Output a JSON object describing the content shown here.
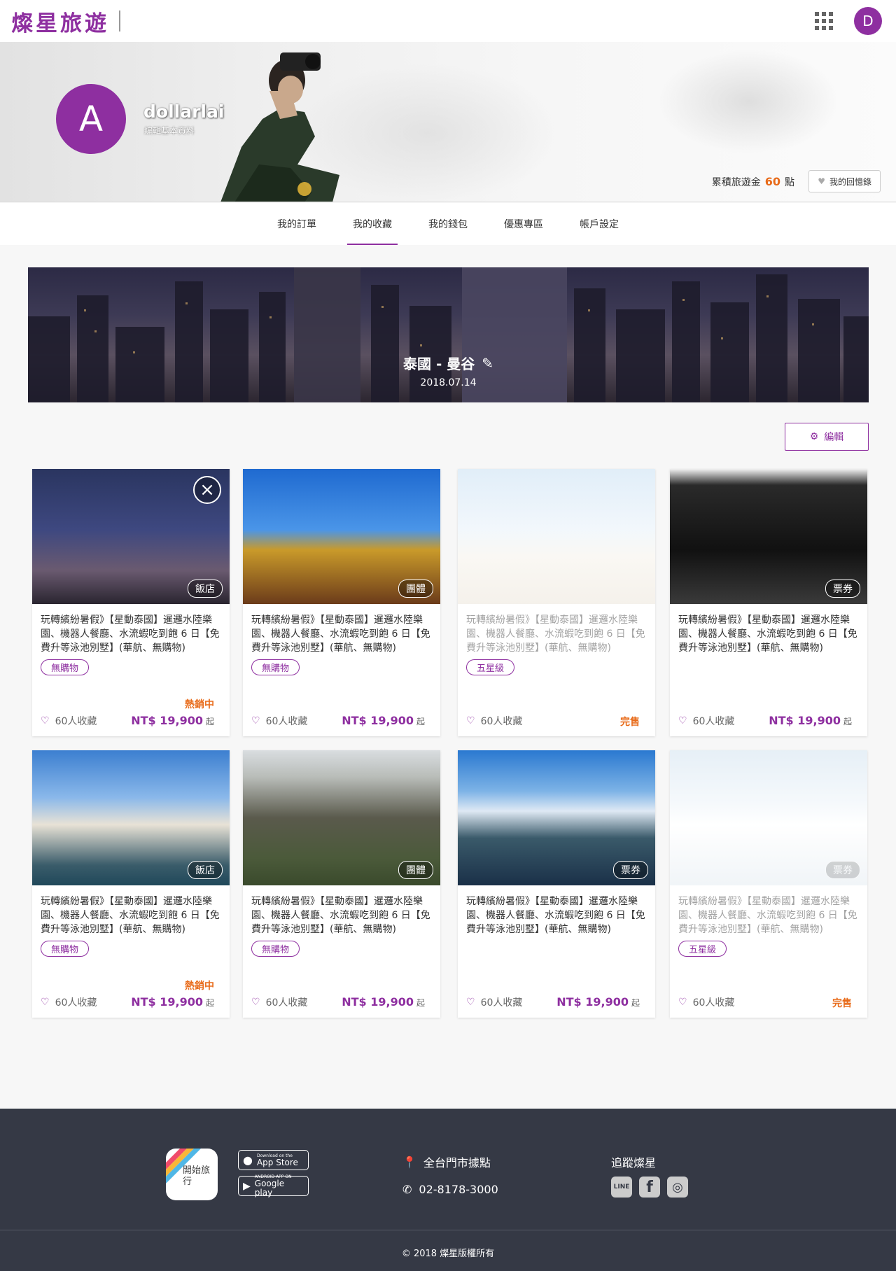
{
  "header": {
    "logo": "燦星旅遊",
    "user_initial": "D"
  },
  "profile": {
    "avatar_initial": "A",
    "name": "dollarlai",
    "edit_link": "編輯基本資料",
    "points_label": "累積旅遊金",
    "points_value": "60",
    "points_unit": "點",
    "memory_button": "我的回憶錄"
  },
  "tabs": [
    {
      "label": "我的訂單",
      "active": false
    },
    {
      "label": "我的收藏",
      "active": true
    },
    {
      "label": "我的錢包",
      "active": false
    },
    {
      "label": "優惠專區",
      "active": false
    },
    {
      "label": "帳戶設定",
      "active": false
    }
  ],
  "collection": {
    "title": "泰國 - 曼谷",
    "date": "2018.07.14",
    "edit_button": "編輯"
  },
  "cards": [
    {
      "badge": "飯店",
      "title": "玩轉繽紛暑假》【星動泰國】暹邏水陸樂園、機器人餐廳、水流蝦吃到飽 6 日【免費升等泳池別墅】(華航、無購物)",
      "tag": "無購物",
      "status": "熱銷中",
      "likes": "60人收藏",
      "price": "NT$ 19,900",
      "price_suffix": "起",
      "removable": true,
      "faded": false
    },
    {
      "badge": "團體",
      "title": "玩轉繽紛暑假》【星動泰國】暹邏水陸樂園、機器人餐廳、水流蝦吃到飽 6 日【免費升等泳池別墅】(華航、無購物)",
      "tag": "無購物",
      "status": "",
      "likes": "60人收藏",
      "price": "NT$ 19,900",
      "price_suffix": "起",
      "removable": false,
      "faded": false
    },
    {
      "badge": "",
      "title": "玩轉繽紛暑假》【星動泰國】暹邏水陸樂園、機器人餐廳、水流蝦吃到飽 6 日【免費升等泳池別墅】(華航、無購物)",
      "tag": "五星級",
      "status": "",
      "likes": "60人收藏",
      "price": "",
      "price_suffix": "",
      "soldout": "完售",
      "removable": false,
      "faded": true
    },
    {
      "badge": "票券",
      "title": "玩轉繽紛暑假》【星動泰國】暹邏水陸樂園、機器人餐廳、水流蝦吃到飽 6 日【免費升等泳池別墅】(華航、無購物)",
      "tag": "",
      "status": "",
      "likes": "60人收藏",
      "price": "NT$ 19,900",
      "price_suffix": "起",
      "removable": false,
      "faded": false
    },
    {
      "badge": "飯店",
      "title": "玩轉繽紛暑假》【星動泰國】暹邏水陸樂園、機器人餐廳、水流蝦吃到飽 6 日【免費升等泳池別墅】(華航、無購物)",
      "tag": "無購物",
      "status": "熱銷中",
      "likes": "60人收藏",
      "price": "NT$ 19,900",
      "price_suffix": "起",
      "removable": false,
      "faded": false
    },
    {
      "badge": "團體",
      "title": "玩轉繽紛暑假》【星動泰國】暹邏水陸樂園、機器人餐廳、水流蝦吃到飽 6 日【免費升等泳池別墅】(華航、無購物)",
      "tag": "無購物",
      "status": "",
      "likes": "60人收藏",
      "price": "NT$ 19,900",
      "price_suffix": "起",
      "removable": false,
      "faded": false
    },
    {
      "badge": "票券",
      "title": "玩轉繽紛暑假》【星動泰國】暹邏水陸樂園、機器人餐廳、水流蝦吃到飽 6 日【免費升等泳池別墅】(華航、無購物)",
      "tag": "",
      "status": "",
      "likes": "60人收藏",
      "price": "NT$ 19,900",
      "price_suffix": "起",
      "removable": false,
      "faded": false
    },
    {
      "badge": "票券",
      "title": "玩轉繽紛暑假》【星動泰國】暹邏水陸樂園、機器人餐廳、水流蝦吃到飽 6 日【免費升等泳池別墅】(華航、無購物)",
      "tag": "五星級",
      "status": "",
      "likes": "60人收藏",
      "price": "",
      "price_suffix": "",
      "soldout": "完售",
      "removable": false,
      "faded": true
    }
  ],
  "footer": {
    "app_icon_text": "開始旅行",
    "appstore_small": "Download on the",
    "appstore_big": "App Store",
    "googleplay_small": "ANDROID APP ON",
    "googleplay_big": "Google play",
    "locations": "全台門市據點",
    "phone": "02-8178-3000",
    "follow": "追蹤燦星",
    "social_line": "LINE",
    "social_fb": "f",
    "copyright": "© 2018 燦星版權所有"
  },
  "colors": {
    "brand": "#8e2fa0",
    "accent": "#e86b1a",
    "footer_bg": "#353945"
  }
}
